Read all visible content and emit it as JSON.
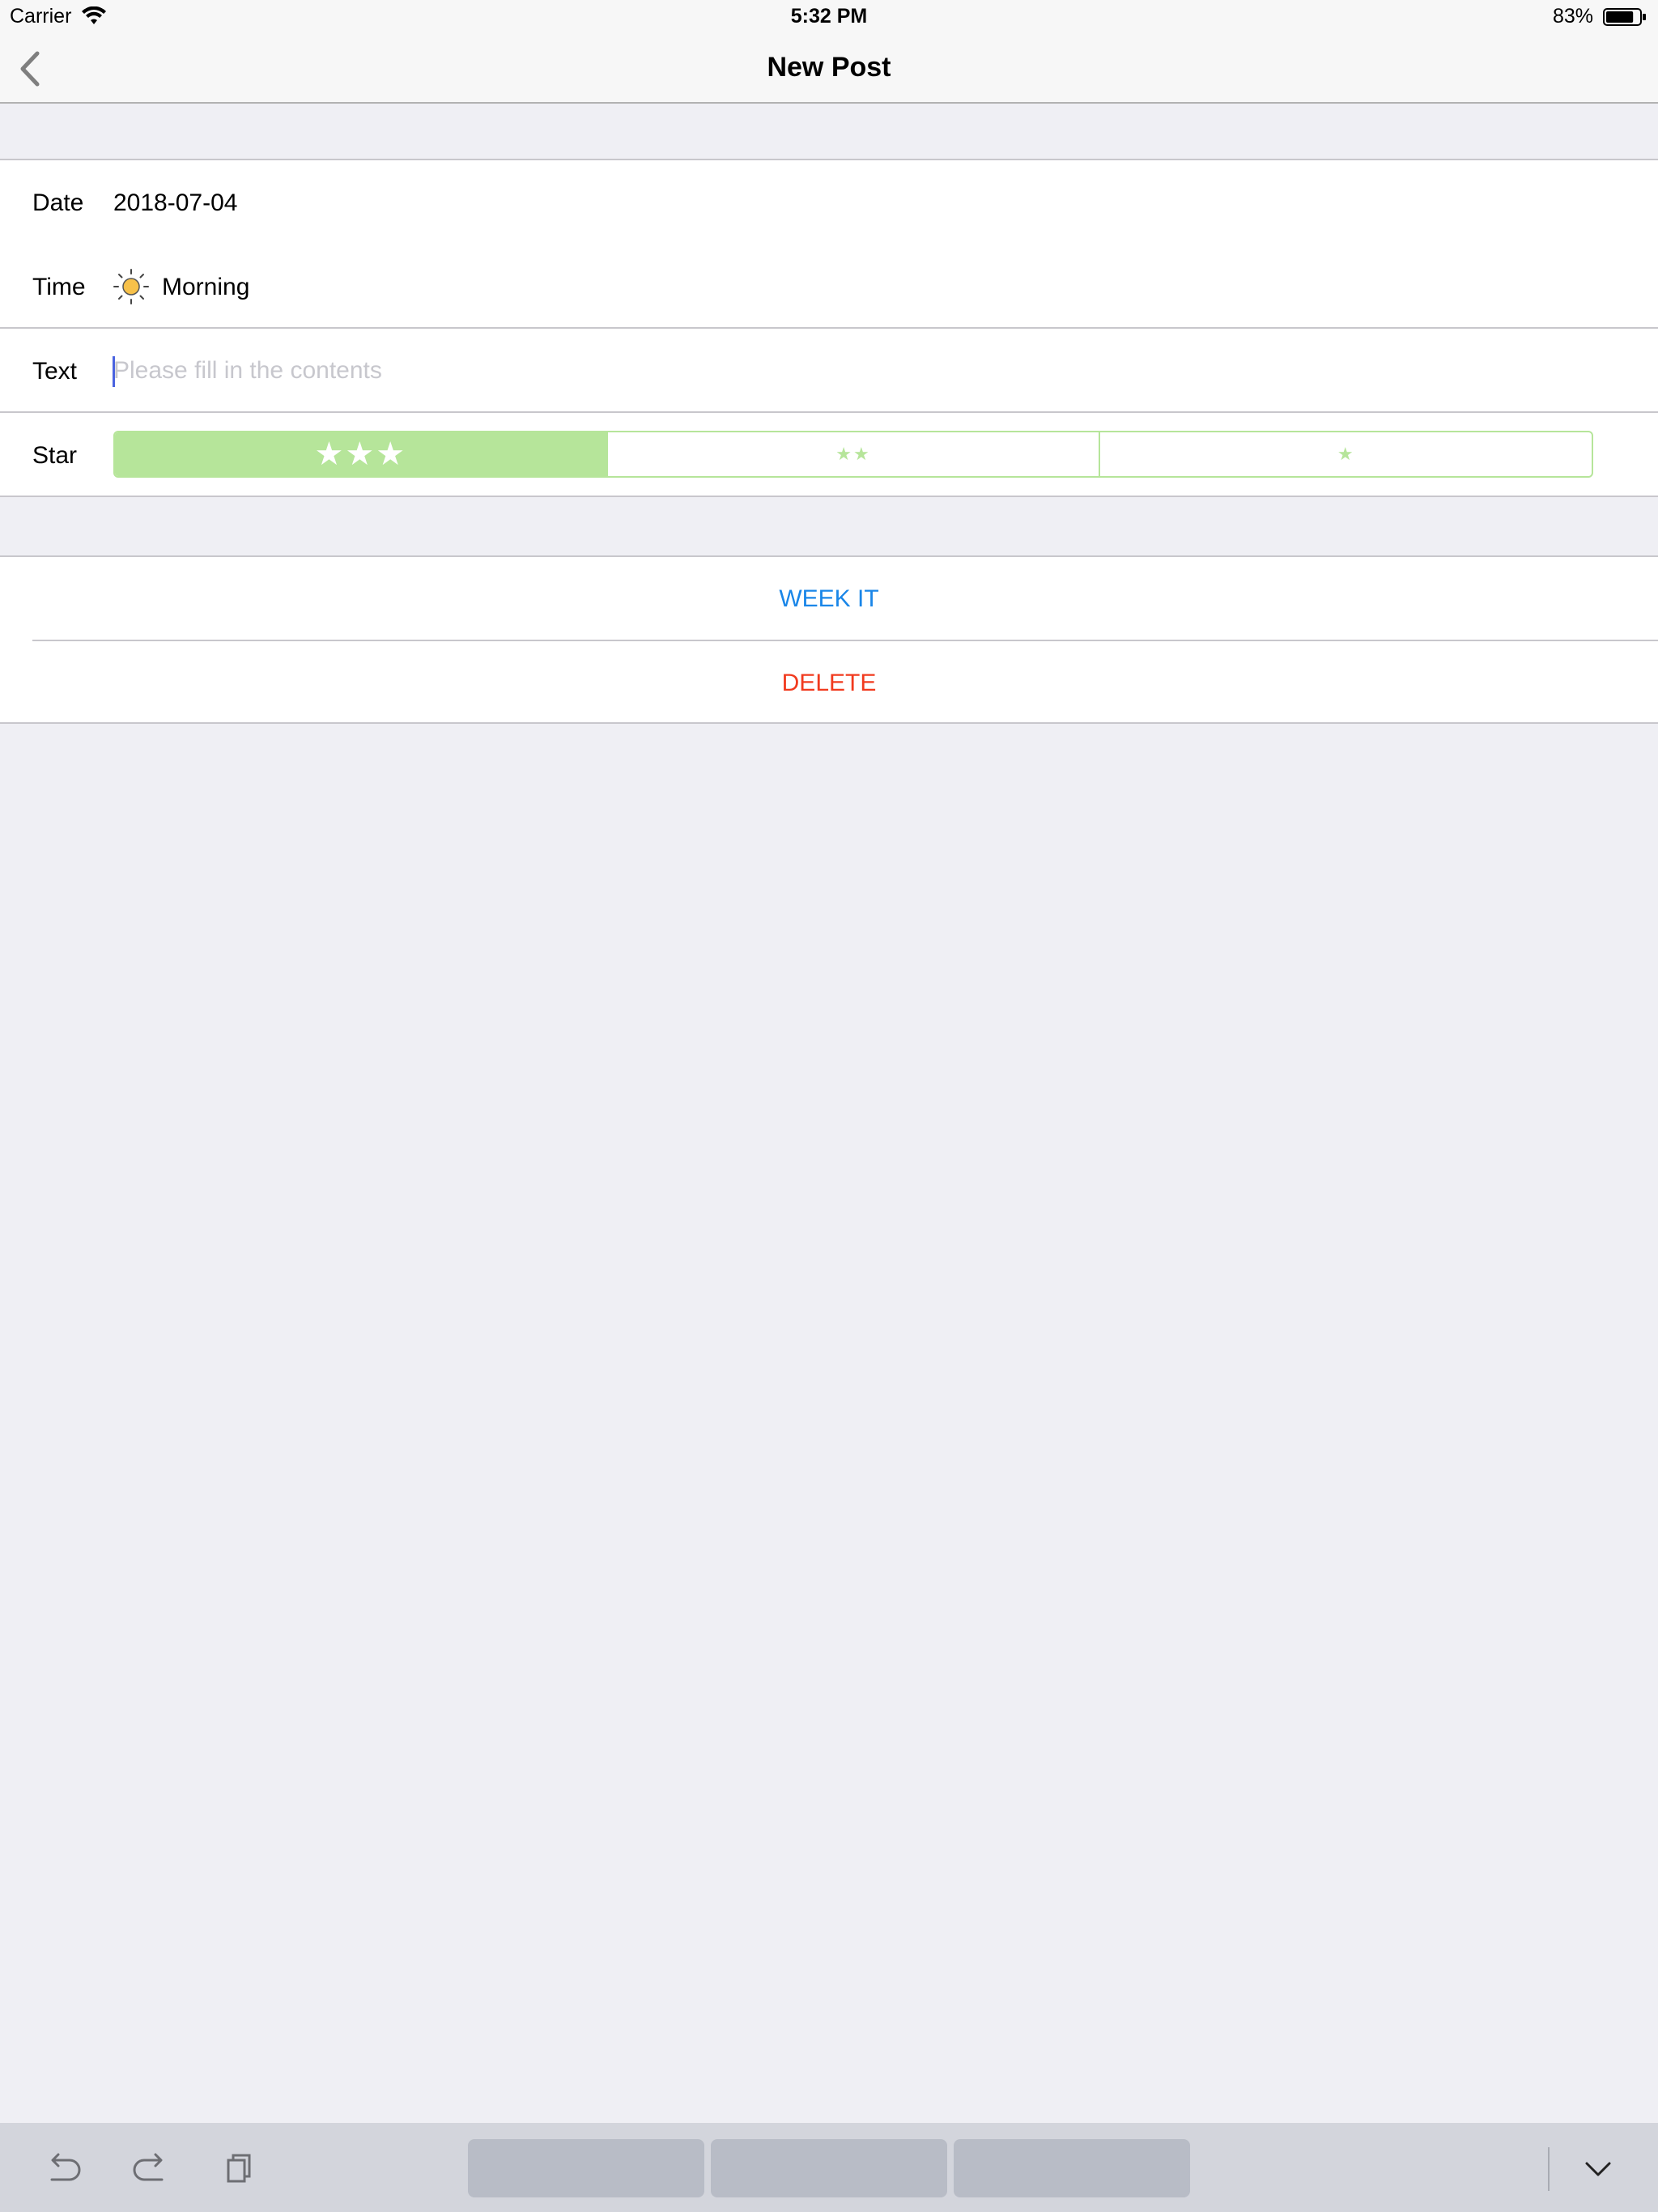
{
  "status_bar": {
    "carrier": "Carrier",
    "time": "5:32 PM",
    "battery_percent": "83%",
    "battery_level": 0.83
  },
  "nav": {
    "title": "New Post",
    "back_icon": "chevron-left-icon"
  },
  "form": {
    "date": {
      "label": "Date",
      "value": "2018-07-04"
    },
    "time": {
      "label": "Time",
      "value": "Morning",
      "icon": "sun-icon"
    },
    "text": {
      "label": "Text",
      "placeholder": "Please fill in the contents",
      "value": ""
    },
    "star": {
      "label": "Star",
      "options": [
        "★★★",
        "★★",
        "★"
      ],
      "selected_index": 0,
      "accent_color": "#b6e59a"
    }
  },
  "actions": {
    "week_it": {
      "label": "WEEK IT",
      "color": "#1a86e8"
    },
    "delete": {
      "label": "DELETE",
      "color": "#f13a1e"
    }
  },
  "keyboard_bar": {
    "icons": [
      "undo-icon",
      "redo-icon",
      "paste-icon",
      "keyboard-dismiss-icon"
    ],
    "suggestions": [
      "",
      "",
      ""
    ]
  }
}
